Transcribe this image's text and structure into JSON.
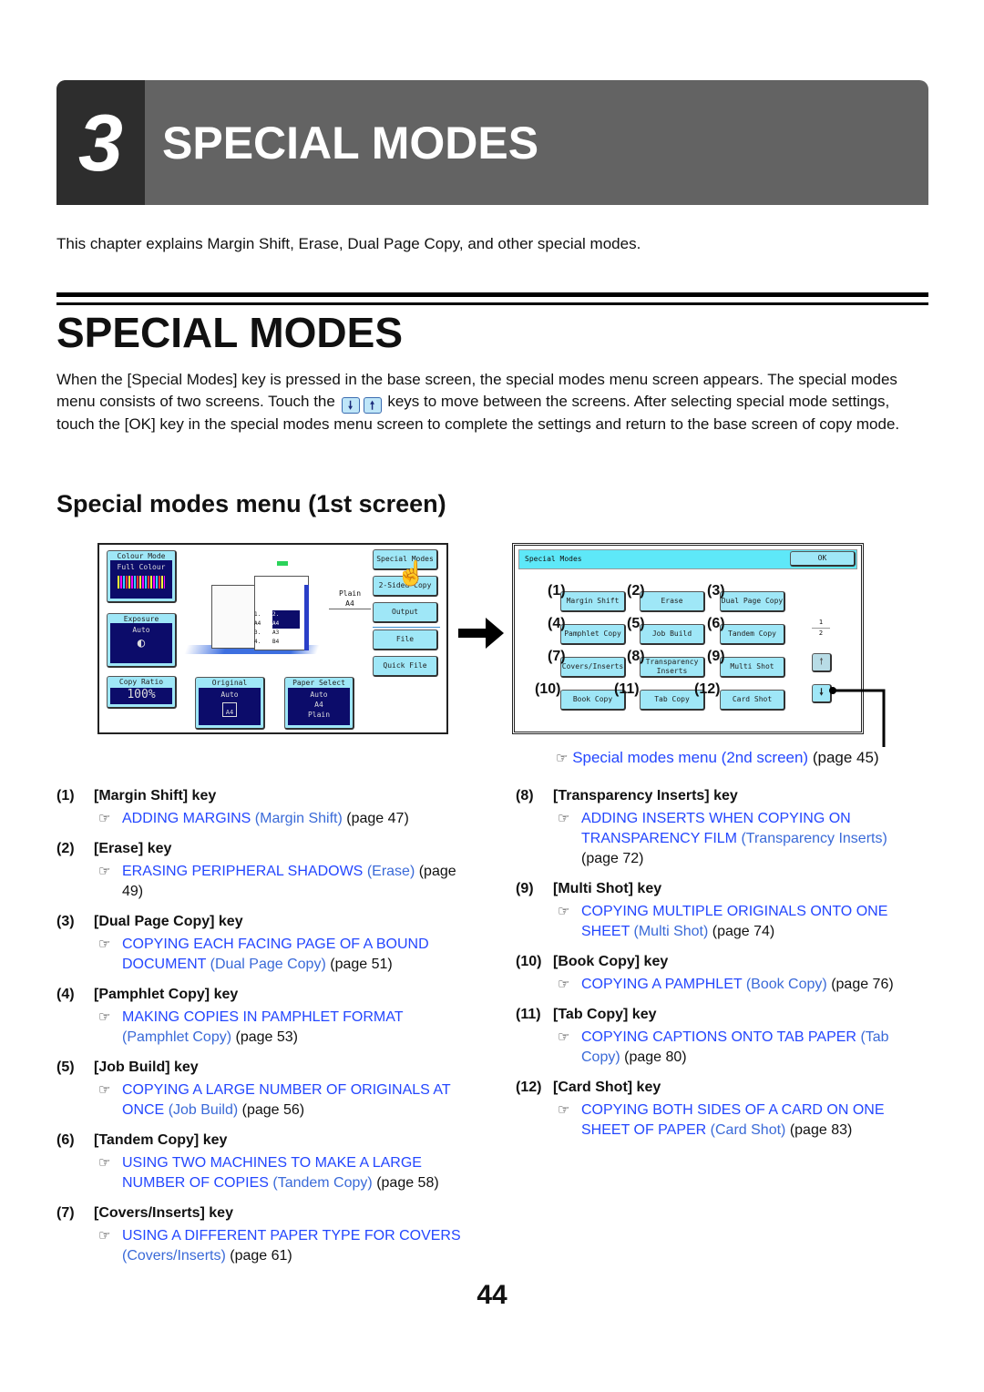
{
  "chapter": {
    "number": "3",
    "title": "SPECIAL MODES"
  },
  "intro": "This chapter explains Margin Shift, Erase, Dual Page Copy, and other special modes.",
  "section": {
    "title": "SPECIAL MODES",
    "para_1": "When the [Special Modes] key is pressed in the base screen, the special modes menu screen appears. The special modes menu consists of two screens. Touch the",
    "para_2": "keys to move between the screens. After selecting special mode settings, touch the [OK] key in the special modes menu screen to complete the settings and return to the base screen of copy mode.",
    "down_key": "🠗",
    "up_key": "🠕"
  },
  "subsection": {
    "title": "Special modes menu (1st screen)"
  },
  "base_screen": {
    "colour_mode": {
      "label": "Colour Mode",
      "value": "Full Colour"
    },
    "exposure": {
      "label": "Exposure",
      "value": "Auto"
    },
    "copy_ratio": {
      "label": "Copy Ratio",
      "value": "100%"
    },
    "original": {
      "label": "Original",
      "value": "Auto",
      "size": "A4"
    },
    "paper_select": {
      "label": "Paper Select",
      "value": "Auto",
      "size": "A4",
      "type": "Plain"
    },
    "output_tray": {
      "type": "Plain",
      "size": "A4"
    },
    "trays": [
      {
        "n": "1.",
        "size": "A4"
      },
      {
        "n": "2.",
        "size": "A4"
      },
      {
        "n": "3.",
        "size": "A3"
      },
      {
        "n": "4.",
        "size": "B4"
      }
    ],
    "buttons": [
      "Special Modes",
      "2-Sided Copy",
      "Output",
      "File",
      "Quick File"
    ]
  },
  "menu_screen": {
    "title": "Special Modes",
    "ok": "OK",
    "page": "1",
    "pages": "2",
    "keys": [
      {
        "num": "(1)",
        "label": "Margin Shift"
      },
      {
        "num": "(2)",
        "label": "Erase"
      },
      {
        "num": "(3)",
        "label": "Dual Page Copy"
      },
      {
        "num": "(4)",
        "label": "Pamphlet Copy"
      },
      {
        "num": "(5)",
        "label": "Job Build"
      },
      {
        "num": "(6)",
        "label": "Tandem Copy"
      },
      {
        "num": "(7)",
        "label": "Covers/Inserts"
      },
      {
        "num": "(8)",
        "label": "Transparency Inserts"
      },
      {
        "num": "(9)",
        "label": "Multi Shot"
      },
      {
        "num": "(10)",
        "label": "Book Copy"
      },
      {
        "num": "(11)",
        "label": "Tab Copy"
      },
      {
        "num": "(12)",
        "label": "Card Shot"
      }
    ]
  },
  "ref_2nd": {
    "link": "Special modes menu (2nd screen)",
    "page": "(page 45)"
  },
  "items": [
    {
      "num": "(1)",
      "title": "[Margin Shift] key",
      "link": "ADDING MARGINS",
      "paren": "(Margin Shift)",
      "page": "(page 47)"
    },
    {
      "num": "(2)",
      "title": "[Erase] key",
      "link": "ERASING PERIPHERAL SHADOWS",
      "paren": "(Erase)",
      "page": "(page 49)"
    },
    {
      "num": "(3)",
      "title": "[Dual Page Copy] key",
      "link": "COPYING EACH FACING PAGE OF A BOUND DOCUMENT",
      "paren": "(Dual Page Copy)",
      "page": "(page 51)"
    },
    {
      "num": "(4)",
      "title": "[Pamphlet Copy] key",
      "link": "MAKING COPIES IN PAMPHLET FORMAT",
      "paren": "(Pamphlet Copy)",
      "page": "(page 53)"
    },
    {
      "num": "(5)",
      "title": "[Job Build] key",
      "link": "COPYING A LARGE NUMBER OF ORIGINALS AT ONCE",
      "paren": "(Job Build)",
      "page": "(page 56)"
    },
    {
      "num": "(6)",
      "title": "[Tandem Copy] key",
      "link": "USING TWO MACHINES TO MAKE A LARGE NUMBER OF COPIES",
      "paren": "(Tandem Copy)",
      "page": "(page 58)"
    },
    {
      "num": "(7)",
      "title": "[Covers/Inserts] key",
      "link": "USING A DIFFERENT PAPER TYPE FOR COVERS",
      "paren": "(Covers/Inserts)",
      "page": "(page 61)"
    },
    {
      "num": "(8)",
      "title": "[Transparency Inserts] key",
      "link": "ADDING INSERTS WHEN COPYING ON TRANSPARENCY FILM",
      "paren": "(Transparency Inserts)",
      "page": "(page 72)"
    },
    {
      "num": "(9)",
      "title": "[Multi Shot] key",
      "link": "COPYING MULTIPLE ORIGINALS ONTO ONE SHEET",
      "paren": "(Multi Shot)",
      "page": "(page 74)"
    },
    {
      "num": "(10)",
      "title": "[Book Copy] key",
      "link": "COPYING A PAMPHLET",
      "paren": "(Book Copy)",
      "page": "(page 76)"
    },
    {
      "num": "(11)",
      "title": "[Tab Copy] key",
      "link": "COPYING CAPTIONS ONTO TAB PAPER",
      "paren": "(Tab Copy)",
      "page": "(page 80)"
    },
    {
      "num": "(12)",
      "title": "[Card Shot] key",
      "link": "COPYING BOTH SIDES OF A CARD ON ONE SHEET OF PAPER",
      "paren": "(Card Shot)",
      "page": "(page 83)"
    }
  ],
  "page_number": "44",
  "colors": {
    "link": "#2447ff",
    "link_paren": "#3a6ad8",
    "screen_key": "#9fe7f7",
    "screen_panel": "#0c0c6a",
    "chapter_bar": "#636363"
  }
}
